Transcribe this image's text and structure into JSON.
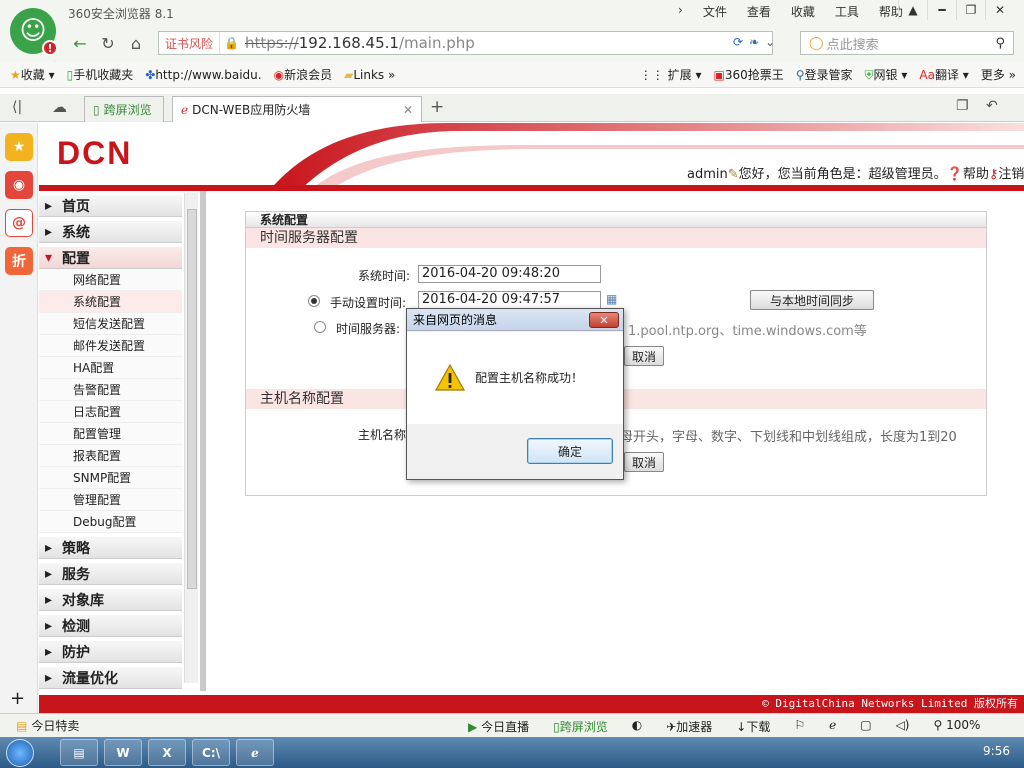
{
  "browser": {
    "title": "360安全浏览器 8.1",
    "menu": [
      "文件",
      "查看",
      "收藏",
      "工具",
      "帮助"
    ],
    "cert_warning": "证书风险",
    "url_protocol": "https://",
    "url_host": "192.168.45.1",
    "url_path": "/main.php",
    "search_placeholder": "点此搜索",
    "bookmarks_left": [
      "收藏",
      "手机收藏夹",
      "http://www.baidu.",
      "新浪会员",
      "Links"
    ],
    "bookmarks_right": [
      "扩展",
      "360抢票王",
      "登录管家",
      "网银",
      "翻译",
      "更多"
    ],
    "tabs": {
      "kuaping": "跨屏浏览",
      "active": "DCN-WEB应用防火墙"
    }
  },
  "app": {
    "logo": "DCN",
    "user": "admin",
    "greeting": "您好，您当前角色是：超级管理员。",
    "help": "帮助",
    "logout": "注销",
    "copyright": "© DigitalChina Networks Limited 版权所有"
  },
  "nav": {
    "groups_top": [
      "首页",
      "系统"
    ],
    "open_group": "配置",
    "sub": [
      "网络配置",
      "系统配置",
      "短信发送配置",
      "邮件发送配置",
      "HA配置",
      "告警配置",
      "日志配置",
      "配置管理",
      "报表配置",
      "SNMP配置",
      "管理配置",
      "Debug配置"
    ],
    "groups_bottom": [
      "策略",
      "服务",
      "对象库",
      "检测",
      "防护",
      "流量优化"
    ]
  },
  "panel": {
    "title": "系统配置",
    "time_section": "时间服务器配置",
    "system_time_label": "系统时间:",
    "system_time_value": "2016-04-20 09:48:20",
    "manual_label": "手动设置时间:",
    "manual_value": "2016-04-20 09:47:57",
    "sync_button": "与本地时间同步",
    "ntp_label": "时间服务器:",
    "ntp_hint": "1.pool.ntp.org、time.windows.com等",
    "cancel1": "取消",
    "host_section": "主机名称配置",
    "host_label": "主机名称",
    "host_hint": "母开头，字母、数字、下划线和中划线组成，长度为1到20",
    "cancel2": "取消"
  },
  "dialog": {
    "title": "来自网页的消息",
    "message": "配置主机名称成功！",
    "ok": "确定",
    "close": "✕"
  },
  "statusbar": {
    "left": "今日特卖",
    "live": "今日直播",
    "kuaping": "跨屏浏览",
    "accel": "加速器",
    "download": "下载",
    "zoom": "100%"
  },
  "taskbar": {
    "clock": "9:56"
  }
}
